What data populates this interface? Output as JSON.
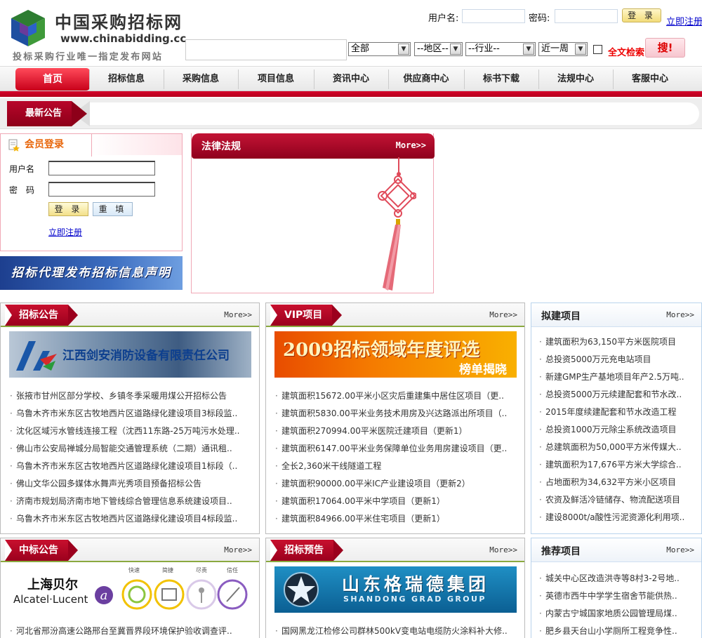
{
  "header": {
    "logo_cn": "中国采购招标网",
    "logo_url": "www.chinabidding.cc",
    "slogan": "投标采购行业唯一指定发布网站",
    "username_label": "用户名:",
    "password_label": "密码:",
    "login_button": "登 录",
    "register_link": "立即注册"
  },
  "search": {
    "type_select": "全部",
    "region_select": "--地区--",
    "industry_select": "--行业--",
    "period_select": "近一周",
    "fulltext_label": "全文检索",
    "search_button": "搜!"
  },
  "nav": {
    "items": [
      "首页",
      "招标信息",
      "采购信息",
      "项目信息",
      "资讯中心",
      "供应商中心",
      "标书下载",
      "法规中心",
      "客服中心"
    ]
  },
  "notice": {
    "label": "最新公告"
  },
  "member": {
    "title": "会员登录",
    "username_label": "用户名",
    "password_label": "密　码",
    "login_button": "登 录",
    "reset_button": "重 填",
    "register_link": "立即注册"
  },
  "statement_banner": "招标代理发布招标信息声明",
  "law": {
    "title": "法律法规",
    "more": "More>>"
  },
  "sections": {
    "zhaobiao": {
      "title": "招标公告",
      "more": "More>>",
      "banner_text": "江西剑安消防设备有限责任公司",
      "items": [
        "张掖市甘州区部分学校、乡镇冬季采暖用煤公开招标公告",
        "乌鲁木齐市米东区古牧地西片区道路绿化建设项目3标段监..",
        "沈化区域污水管线连接工程（沈西11东路-25万吨污水处理..",
        "佛山市公安局禅城分局智能交通管理系统（二期）通讯租..",
        "乌鲁木齐市米东区古牧地西片区道路绿化建设项目1标段（..",
        "佛山文华公园多媒体水舞声光秀项目预备招标公告",
        "济南市规划局济南市地下管线综合管理信息系统建设项目..",
        "乌鲁木齐市米东区古牧地西片区道路绿化建设项目4标段监.."
      ]
    },
    "vip": {
      "title": "VIP项目",
      "more": "More>>",
      "banner_text": "2009招标领域年度评选",
      "banner_sub": "榜单揭晓",
      "items": [
        "建筑面积15672.00平米小区灾后重建集中居住区项目（更..",
        "建筑面积5830.00平米业务技术用房及兴达路派出所项目（..",
        "建筑面积270994.00平米医院迁建项目（更新1）",
        "建筑面积6147.00平米业务保障单位业务用房建设项目（更..",
        "全长2,360米干线隧道工程",
        "建筑面积90000.00平米IC产业建设项目（更新2）",
        "建筑面积17064.00平米中学项目（更新1）",
        "建筑面积84966.00平米住宅项目（更新1）"
      ]
    },
    "nijian": {
      "title": "拟建项目",
      "more": "More>>",
      "items": [
        "建筑面积为63,150平方米医院项目",
        "总投资5000万元充电站项目",
        "新建GMP生产基地项目年产2.5万吨..",
        "总投资5000万元续建配套和节水改..",
        "2015年度续建配套和节水改造工程",
        "总投资1000万元除尘系统改造项目",
        "总建筑面积为50,000平方米传媒大..",
        "建筑面积为17,676平方米大学综合..",
        "占地面积为34,632平方米小区项目",
        "农资及鲜活冷链储存、物流配送项目",
        "建设8000t/a酸性污泥资源化利用项.."
      ]
    },
    "zhongbiao": {
      "title": "中标公告",
      "more": "More>>",
      "banner_brand_cn": "上海贝尔",
      "banner_brand_en": "Alcatel·Lucent",
      "banner_icons": [
        "快速",
        "简捷",
        "尽责",
        "信任"
      ],
      "items": [
        "河北省邢汾高速公路邢台至冀晋界段环境保护验收调查评.."
      ]
    },
    "yugao": {
      "title": "招标预告",
      "more": "More>>",
      "banner_cn": "山东格瑞德集团",
      "banner_en": "SHANDONG GRAD GROUP",
      "items": [
        "国网黑龙江检修公司群林500kV变电站电缆防火涂料补大修.."
      ]
    },
    "tuijian": {
      "title": "推荐项目",
      "more": "More>>",
      "items": [
        "城关中心区改造洪寺等8村3-2号地..",
        "英德市西牛中学学生宿舍节能供热..",
        "内蒙古宁城国家地质公园管理局煤..",
        "肥乡县天台山小学厕所工程竞争性.."
      ]
    }
  }
}
